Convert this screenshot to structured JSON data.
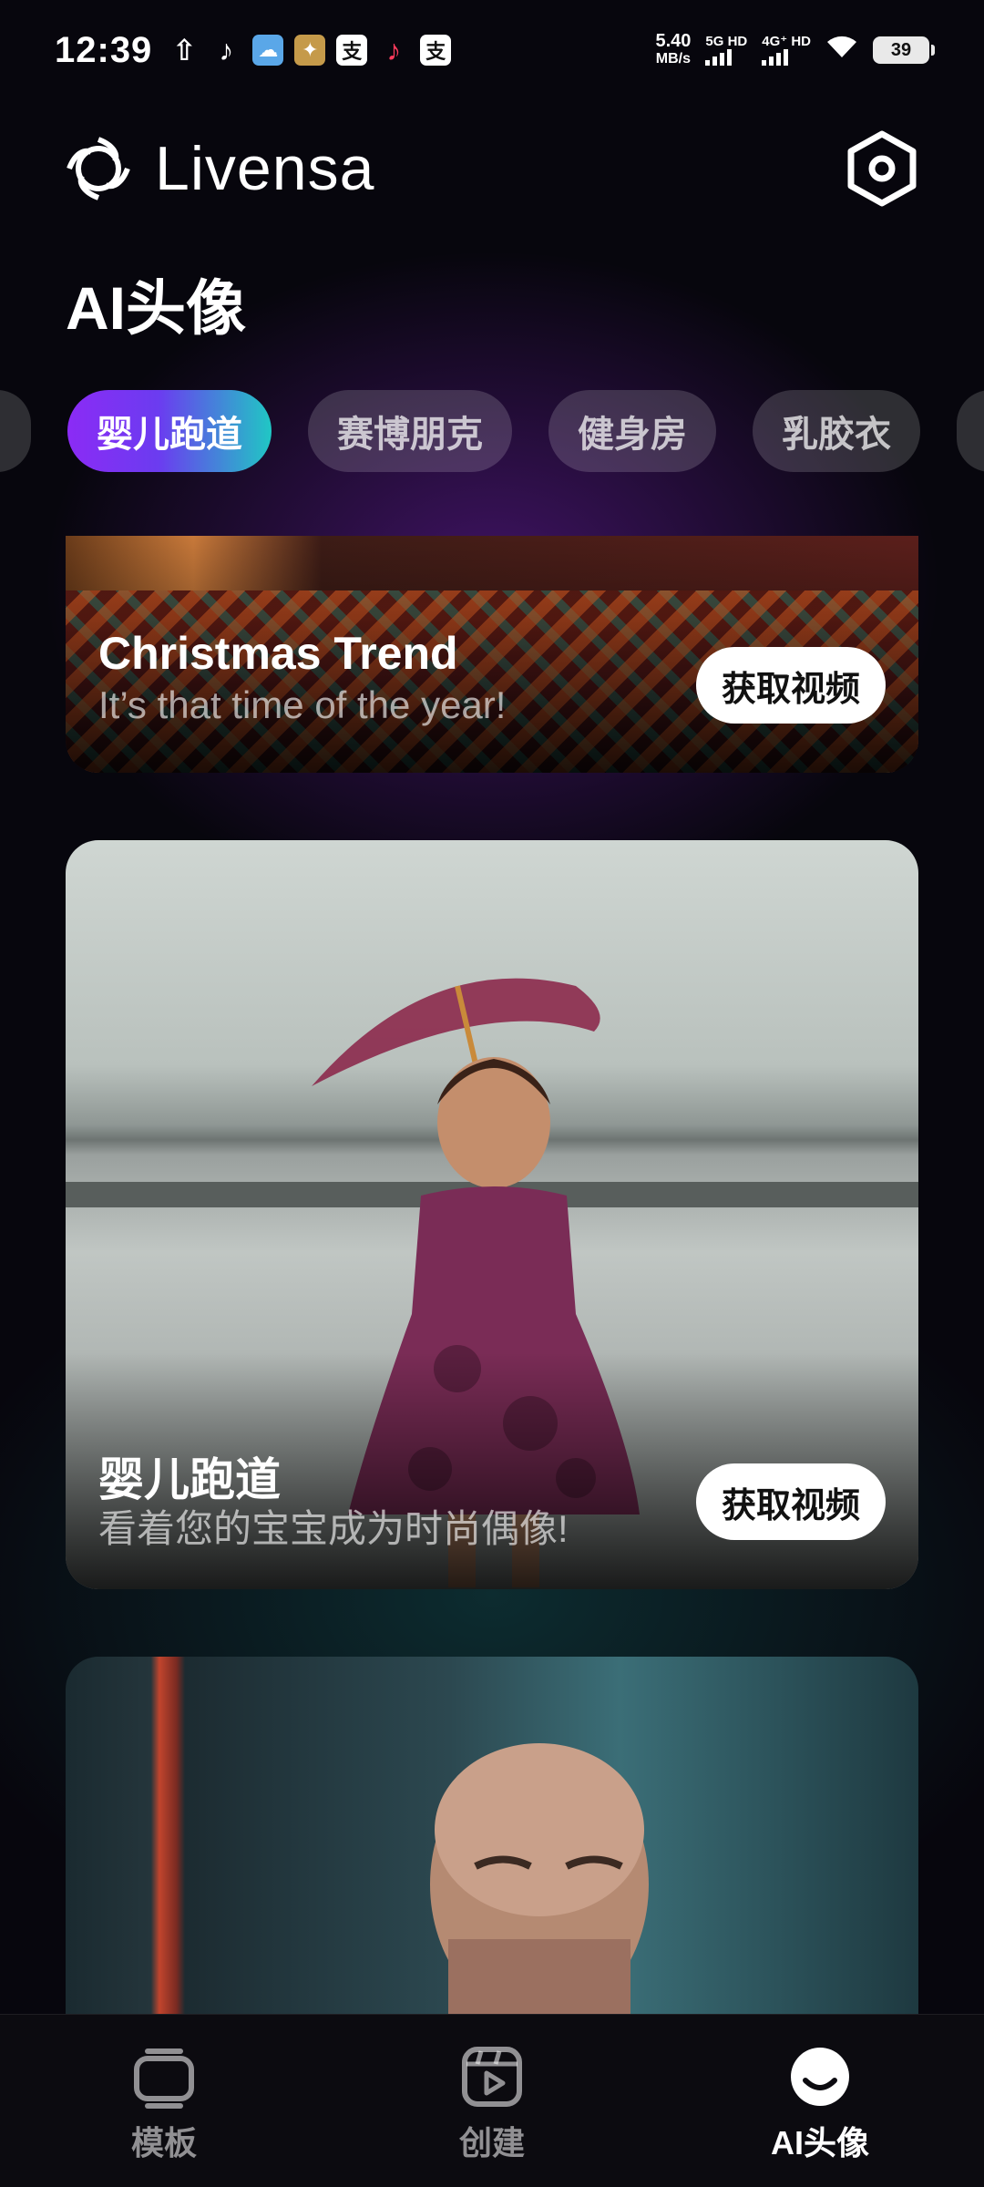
{
  "status_bar": {
    "time": "12:39",
    "net_speed_value": "5.40",
    "net_speed_unit": "MB/s",
    "sim1": "5G HD",
    "sim2": "4G⁺ HD",
    "battery": "39",
    "notification_icons": [
      "upload-icon",
      "tiktok-icon",
      "cloud-app-icon",
      "photo-app-icon",
      "alipay-icon",
      "tiktok-lite-icon",
      "alipay-icon"
    ]
  },
  "header": {
    "brand": "Livensa",
    "title": "AI头像"
  },
  "categories": {
    "items": [
      "婴儿跑道",
      "赛博朋克",
      "健身房",
      "乳胶衣"
    ],
    "active": "婴儿跑道"
  },
  "cards": [
    {
      "title": "Christmas Trend",
      "subtitle": "It’s that time of the year!",
      "button": "获取视频"
    },
    {
      "title": "婴儿跑道",
      "subtitle": "看着您的宝宝成为时尚偶像!",
      "button": "获取视频"
    }
  ],
  "bottom_nav": {
    "items": [
      "模板",
      "创建",
      "AI头像"
    ],
    "active": "AI头像"
  },
  "colors": {
    "accent_gradient_start": "#8b2bf5",
    "accent_gradient_end": "#20c7c4",
    "background": "#07060d"
  }
}
